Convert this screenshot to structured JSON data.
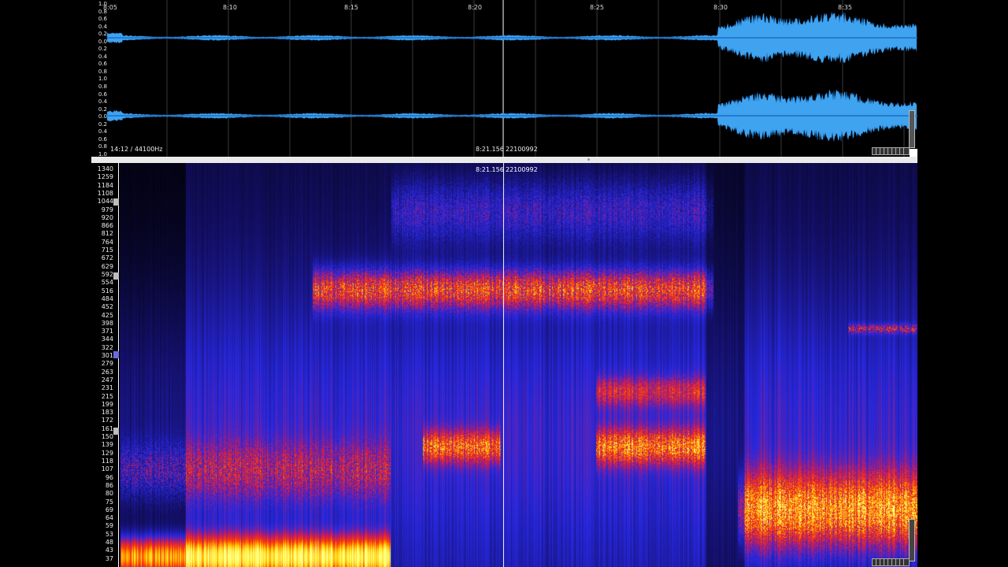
{
  "waveform": {
    "time_labels": [
      "8:05",
      "8:10",
      "8:15",
      "8:20",
      "8:25",
      "8:30",
      "8:35"
    ],
    "amplitude_labels_ch1": [
      "1.0",
      "0.8",
      "0.6",
      "0.4",
      "0.2",
      "0.0",
      "0.2",
      "0.4",
      "0.6",
      "0.8",
      "1.0"
    ],
    "amplitude_labels_ch2": [
      "0.8",
      "0.6",
      "0.4",
      "0.2",
      "0.0",
      "0.2",
      "0.4",
      "0.6",
      "0.8",
      "1.0"
    ],
    "position_info": "14:12 / 44100Hz",
    "cursor_time": "8:21.156",
    "cursor_sample": "22100992",
    "colors": {
      "wave": "#3fa3f0",
      "wave_dark": "#1e6fbf",
      "grid": "#3a3a3a"
    }
  },
  "spectrogram": {
    "cursor_time": "8:21.156",
    "cursor_sample": "22100992",
    "frequency_labels": [
      "1340",
      "1259",
      "1184",
      "1108",
      "1044",
      "979",
      "920",
      "866",
      "812",
      "764",
      "715",
      "672",
      "629",
      "592",
      "554",
      "516",
      "484",
      "452",
      "425",
      "398",
      "371",
      "344",
      "322",
      "301",
      "279",
      "263",
      "247",
      "231",
      "215",
      "199",
      "183",
      "172",
      "161",
      "150",
      "139",
      "129",
      "118",
      "107",
      "96",
      "86",
      "80",
      "75",
      "69",
      "64",
      "59",
      "53",
      "48",
      "43",
      "37"
    ],
    "colormap": [
      "#000000",
      "#14106a",
      "#2828e0",
      "#c81a5a",
      "#ff4000",
      "#ffd000",
      "#ffff80"
    ]
  },
  "icons": {
    "zoom_control": "zoom-slider-icon",
    "scroll_handle": "scroll-handle-icon"
  }
}
